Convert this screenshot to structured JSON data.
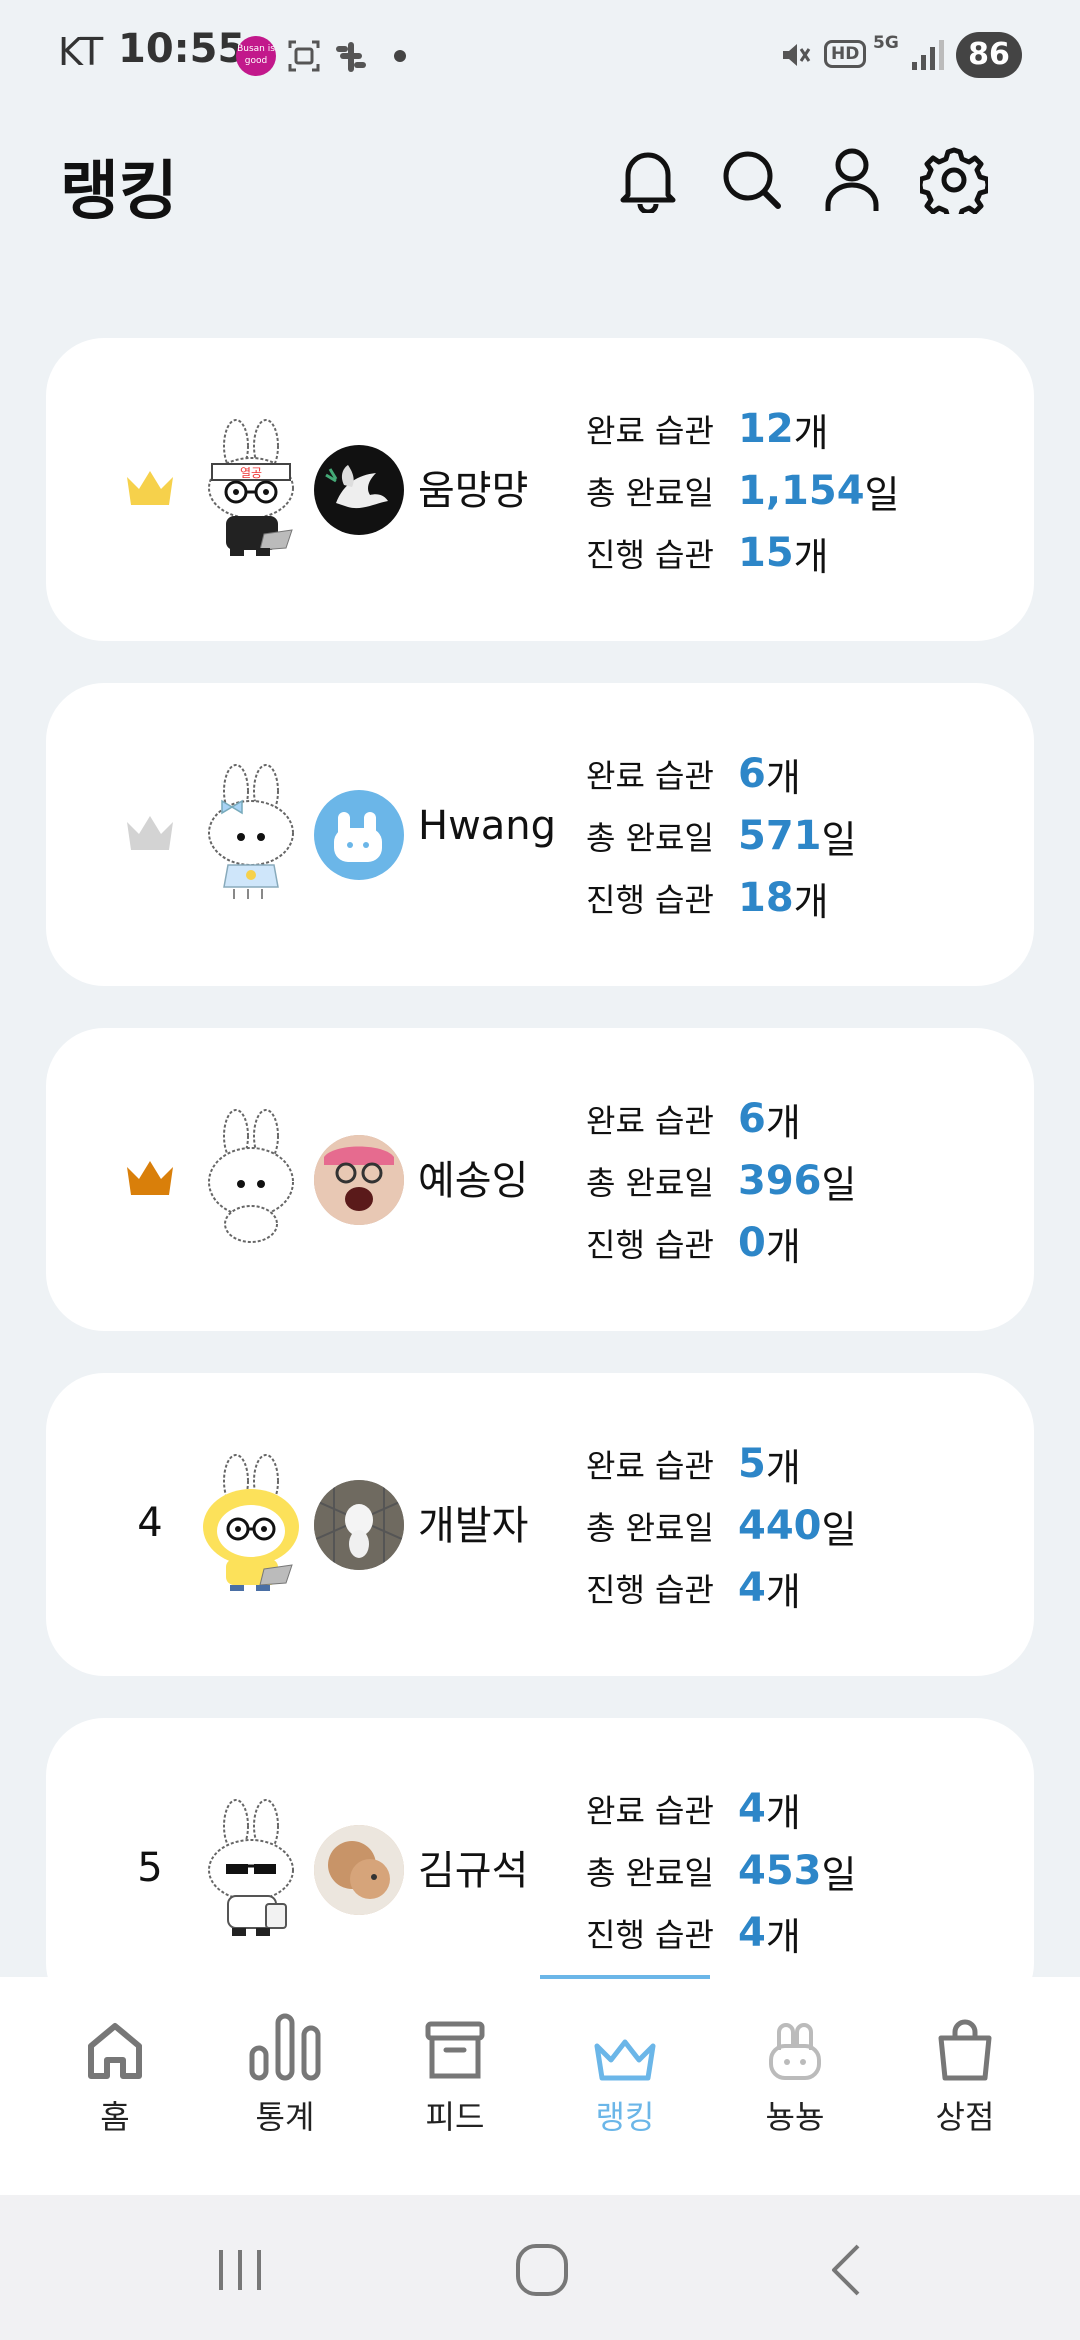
{
  "status_bar": {
    "carrier": "KT",
    "time": "10:55",
    "busan_badge": "Busan is good",
    "network": "5G",
    "hd": "HD",
    "battery": "86"
  },
  "header": {
    "title": "랭킹"
  },
  "colors": {
    "accent": "#2D86C8",
    "nav_active": "#6BB6E8",
    "crown_gold": "#F6D14B",
    "crown_silver": "#D3D3D3",
    "crown_bronze": "#D97F0A",
    "background": "#EEF2F5"
  },
  "labels": {
    "completed_habits": "완료 습관",
    "total_days": "총 완료일",
    "ongoing_habits": "진행 습관",
    "unit_count": "개",
    "unit_day": "일"
  },
  "rankings": [
    {
      "rank": "1",
      "badge": "crown-gold-icon",
      "name": "움먕먕",
      "completed": "12",
      "total_days": "1,154",
      "ongoing": "15",
      "character_tag": "열공"
    },
    {
      "rank": "2",
      "badge": "crown-silver-icon",
      "name": "Hwang",
      "completed": "6",
      "total_days": "571",
      "ongoing": "18"
    },
    {
      "rank": "3",
      "badge": "crown-bronze-icon",
      "name": "예송잉",
      "completed": "6",
      "total_days": "396",
      "ongoing": "0"
    },
    {
      "rank": "4",
      "name": "개발자",
      "completed": "5",
      "total_days": "440",
      "ongoing": "4"
    },
    {
      "rank": "5",
      "name": "김규석",
      "completed": "4",
      "total_days": "453",
      "ongoing": "4"
    }
  ],
  "bottom_nav": {
    "items": [
      {
        "label": "홈",
        "icon": "home-icon"
      },
      {
        "label": "통계",
        "icon": "stats-icon"
      },
      {
        "label": "피드",
        "icon": "feed-icon"
      },
      {
        "label": "랭킹",
        "icon": "crown-icon",
        "active": true
      },
      {
        "label": "뇽뇽",
        "icon": "bunny-icon"
      },
      {
        "label": "상점",
        "icon": "shop-icon"
      }
    ]
  }
}
